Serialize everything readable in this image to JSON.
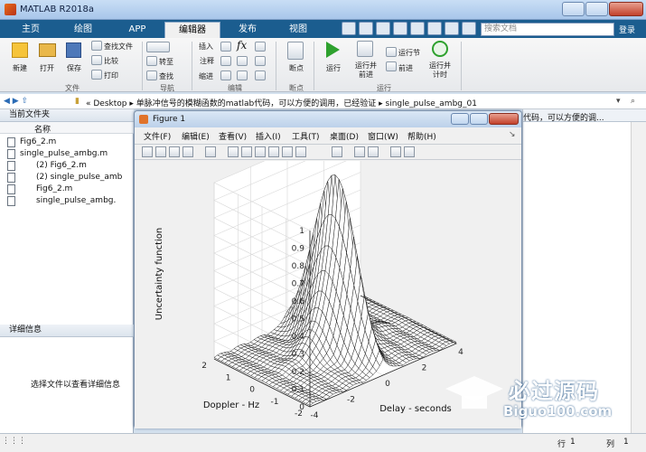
{
  "app": {
    "title": "MATLAB R2018a"
  },
  "tabs": [
    "主页",
    "绘图",
    "APP",
    "编辑器",
    "发布",
    "视图"
  ],
  "search": {
    "placeholder": "搜索文档"
  },
  "login": "登录",
  "ribbon": {
    "file": {
      "new": "新建",
      "open": "打开",
      "save": "保存",
      "find_files": "查找文件",
      "compare": "比较",
      "print": "打印",
      "group": "文件"
    },
    "nav": {
      "goto": "转至",
      "find": "查找",
      "group": "导航"
    },
    "edit": {
      "insert": "插入",
      "comment": "注释",
      "indent": "缩进",
      "fx": "fx",
      "group": "编辑"
    },
    "breakpoints": {
      "label": "断点",
      "group": "断点"
    },
    "run": {
      "run": "运行",
      "run_advance": "运行并\n前进",
      "run_section": "运行节",
      "advance": "前进",
      "run_time": "运行并\n计时",
      "group": "运行"
    }
  },
  "address": {
    "path": "« Desktop ▸ 单脉冲信号的模糊函数的matlab代码，可以方便的调用，已经验证 ▸ single_pulse_ambg_01"
  },
  "editor_tail": "代码，可以方便的调...",
  "current_folder": {
    "title": "当前文件夹",
    "column": "名称",
    "files": [
      "Fig6_2.m",
      "single_pulse_ambg.m",
      "(2) Fig6_2.m",
      "(2) single_pulse_amb",
      "Fig6_2.m",
      "single_pulse_ambg."
    ]
  },
  "details": {
    "title": "详细信息",
    "hint": "选择文件以查看详细信息"
  },
  "status": {
    "row_label": "行",
    "row": "1",
    "col_label": "列",
    "col": "1"
  },
  "figure": {
    "title": "Figure 1",
    "menu": [
      "文件(F)",
      "编辑(E)",
      "查看(V)",
      "插入(I)",
      "工具(T)",
      "桌面(D)",
      "窗口(W)",
      "帮助(H)"
    ],
    "zlabel": "Uncertainty function",
    "xlabel": "Delay - seconds",
    "ylabel": "Doppler - Hz",
    "zticks": [
      "0",
      "0.1",
      "0.2",
      "0.3",
      "0.4",
      "0.5",
      "0.6",
      "0.7",
      "0.8",
      "0.9",
      "1"
    ],
    "xticks": [
      "-4",
      "-2",
      "0",
      "2",
      "4"
    ],
    "yticks": [
      "-2",
      "-1",
      "0",
      "1",
      "2"
    ]
  },
  "chart_data": {
    "type": "surface",
    "title": "",
    "xlabel": "Delay - seconds",
    "ylabel": "Doppler - Hz",
    "zlabel": "Uncertainty function",
    "xlim": [
      -4,
      4
    ],
    "ylim": [
      -2,
      2
    ],
    "zlim": [
      0,
      1
    ],
    "peak": {
      "x": 0,
      "y": 0,
      "z": 1
    },
    "grid": true
  },
  "watermark": {
    "title": "必过源码",
    "url": "Biguo100.com"
  }
}
